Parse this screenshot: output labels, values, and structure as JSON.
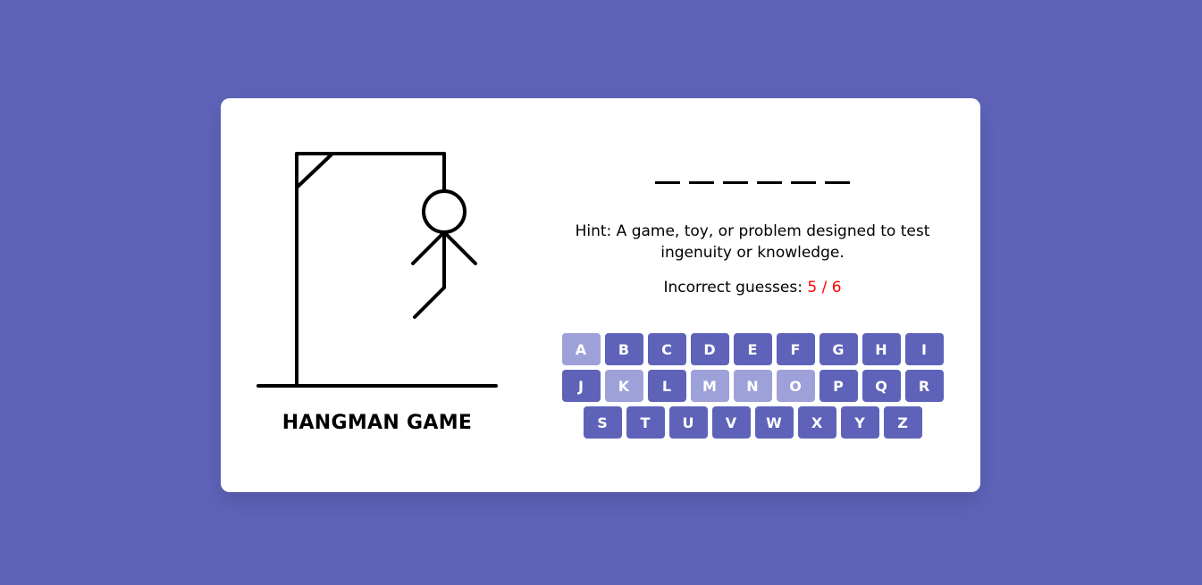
{
  "game": {
    "title": "HANGMAN GAME",
    "word_length": 6,
    "hint": "Hint: A game, toy, or problem designed to test ingenuity or knowledge.",
    "guesses_label": "Incorrect guesses: ",
    "guesses_count": "5 / 6",
    "wrong_guesses": 5,
    "max_guesses": 6
  },
  "keyboard": {
    "keys": [
      "A",
      "B",
      "C",
      "D",
      "E",
      "F",
      "G",
      "H",
      "I",
      "J",
      "K",
      "L",
      "M",
      "N",
      "O",
      "P",
      "Q",
      "R",
      "S",
      "T",
      "U",
      "V",
      "W",
      "X",
      "Y",
      "Z"
    ],
    "used": [
      "A",
      "K",
      "M",
      "N",
      "O"
    ]
  },
  "colors": {
    "background": "#5e63b9",
    "key": "#5e63b9",
    "key_used": "#9ea1d9",
    "count": "#ff0000"
  }
}
